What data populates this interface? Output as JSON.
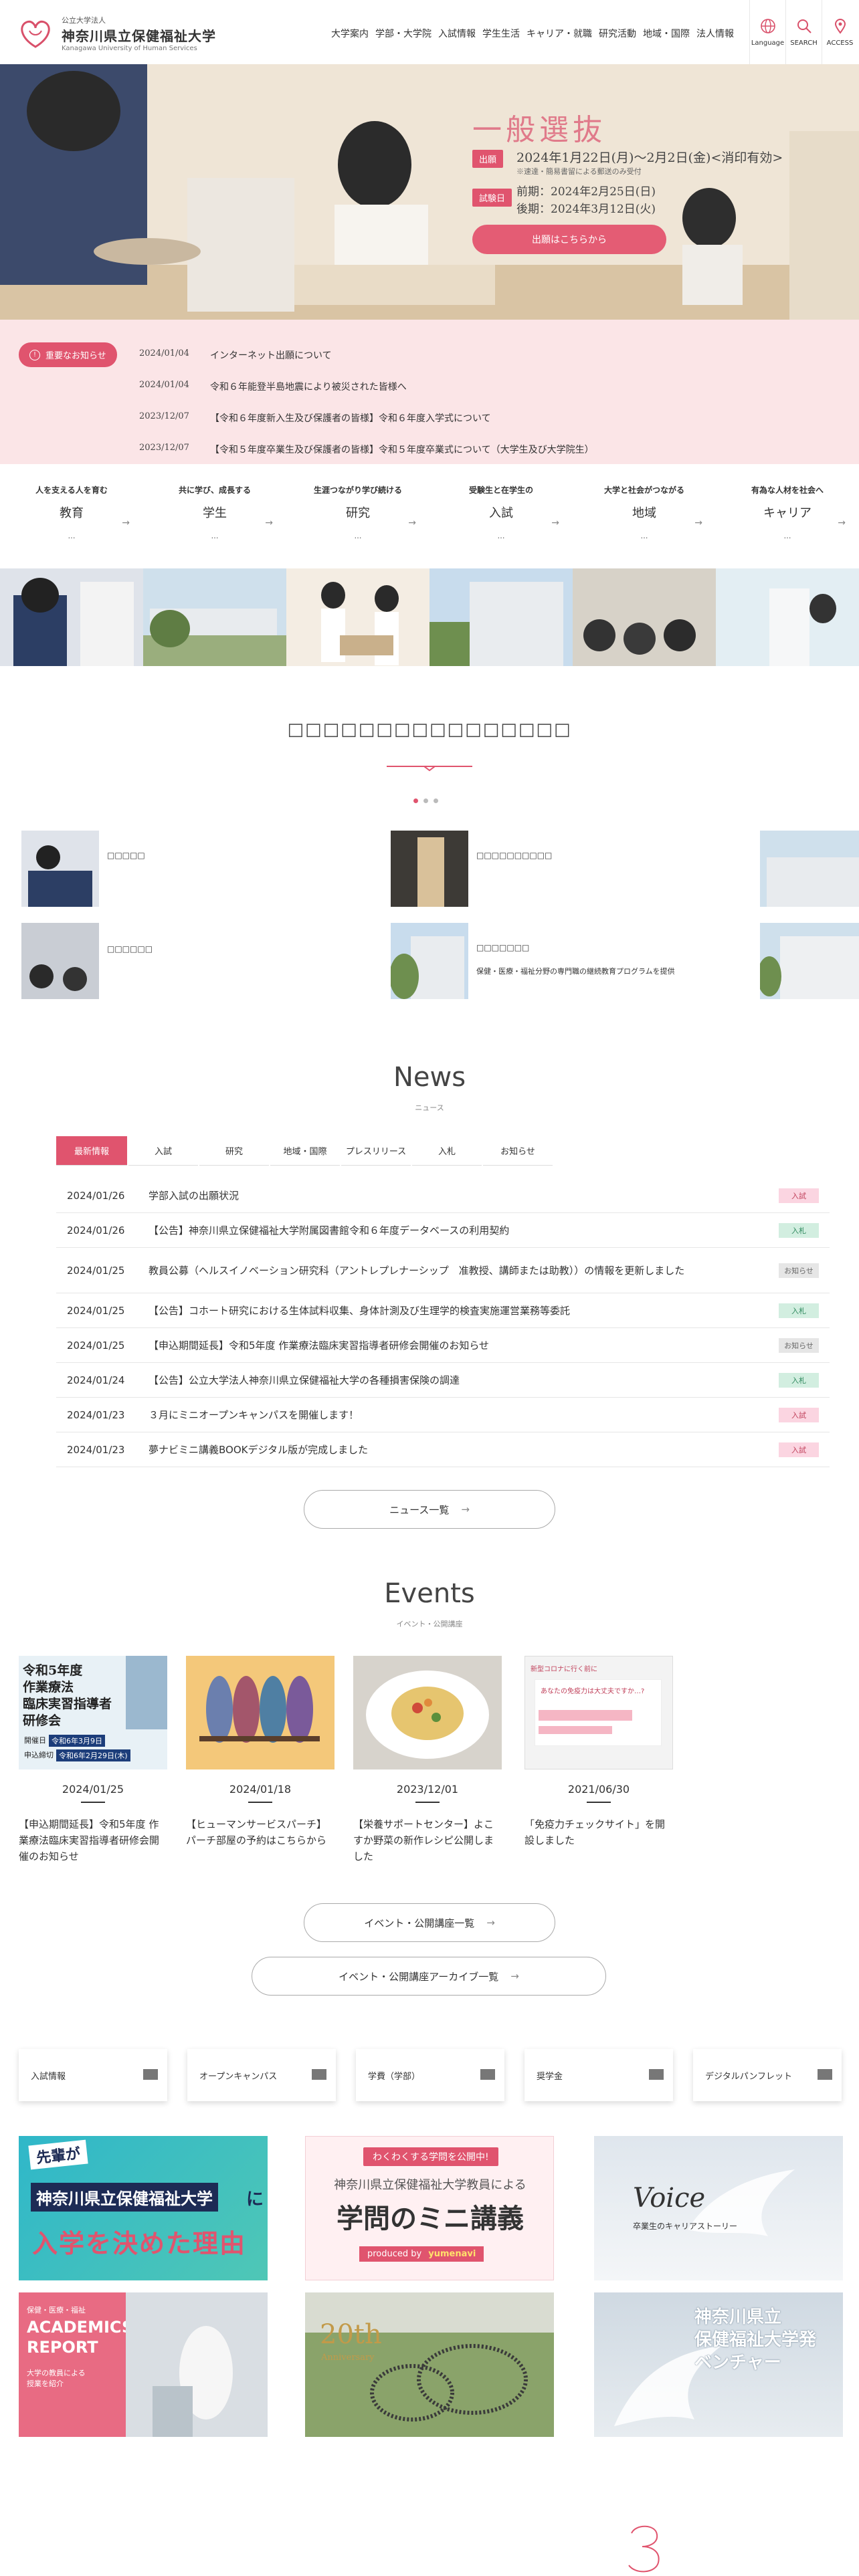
{
  "header": {
    "logo_top": "公立大学法人",
    "logo_name": "神奈川県立保健福祉大学",
    "logo_en": "Kanagawa University of Human Services",
    "nav": [
      "大学案内",
      "学部・大学院",
      "入試情報",
      "学生生活",
      "キャリア・就職",
      "研究活動",
      "地域・国際",
      "法人情報"
    ],
    "tools": [
      {
        "label": "Language",
        "icon": "globe-icon"
      },
      {
        "label": "SEARCH",
        "icon": "search-icon"
      },
      {
        "label": "ACCESS",
        "icon": "map-pin-icon"
      }
    ]
  },
  "hero": {
    "title": "一般選抜",
    "tag1": "出願",
    "line1": "2024年1月22日(月)～2月2日(金)<消印有効>",
    "line1b": "※速達・簡易書留による郵送のみ受付",
    "tag2": "試験日",
    "line2": "前期：2024年2月25日(日)",
    "line3": "後期：2024年3月12日(火)",
    "button": "出願はこちらから"
  },
  "notice": {
    "badge": "重要なお知らせ",
    "items": [
      {
        "date": "2024/01/04",
        "text": "インターネット出願について"
      },
      {
        "date": "2024/01/04",
        "text": "令和６年能登半島地震により被災された皆様へ"
      },
      {
        "date": "2023/12/07",
        "text": "【令和６年度新入生及び保護者の皆様】令和６年度入学式について"
      },
      {
        "date": "2023/12/07",
        "text": "【令和５年度卒業生及び保護者の皆様】令和５年度卒業式について（大学生及び大学院生）"
      }
    ]
  },
  "concepts": [
    {
      "head": "人を支える人を育む",
      "title": "教育",
      "sub": "…"
    },
    {
      "head": "共に学び、成長する",
      "title": "学生",
      "sub": "…"
    },
    {
      "head": "生涯つながり学び続ける",
      "title": "研究",
      "sub": "…"
    },
    {
      "head": "受験生と在学生の",
      "title": "入試",
      "sub": "…"
    },
    {
      "head": "大学と社会がつながる",
      "title": "地域",
      "sub": "…"
    },
    {
      "head": "有為な人材を社会へ",
      "title": "キャリア",
      "sub": "…"
    }
  ],
  "mid": {
    "heading": "□□□□□□□□□□□□□□□□",
    "items": [
      {
        "label": "□□□□□",
        "extra": ""
      },
      {
        "label": "□□□□□□□□□□",
        "extra": ""
      },
      {
        "label": "□□□□□□",
        "extra": ""
      },
      {
        "label": "□□□□□□□",
        "extra": "保健・医療・福祉分野の専門職の継続教育プログラムを提供"
      }
    ]
  },
  "news": {
    "title": "News",
    "subtitle": "ニュース",
    "tabs": [
      "最新情報",
      "入試",
      "研究",
      "地域・国際",
      "プレスリリース",
      "入札",
      "お知らせ"
    ],
    "active_tab": 0,
    "rows": [
      {
        "date": "2024/01/26",
        "text": "学部入試の出願状況",
        "badge": "入試",
        "kind": "pink"
      },
      {
        "date": "2024/01/26",
        "text": "【公告】神奈川県立保健福祉大学附属図書館令和６年度データベースの利用契約",
        "badge": "入札",
        "kind": "green"
      },
      {
        "date": "2024/01/25",
        "text": "教員公募（ヘルスイノベーション研究科（アントレプレナーシップ　准教授、講師または助教））の情報を更新しました",
        "badge": "お知らせ",
        "kind": "gray"
      },
      {
        "date": "2024/01/25",
        "text": "【公告】コホート研究における生体試料収集、身体計測及び生理学的検査実施運営業務等委託",
        "badge": "入札",
        "kind": "green"
      },
      {
        "date": "2024/01/25",
        "text": "【申込期間延長】令和5年度 作業療法臨床実習指導者研修会開催のお知らせ",
        "badge": "お知らせ",
        "kind": "gray"
      },
      {
        "date": "2024/01/24",
        "text": "【公告】公立大学法人神奈川県立保健福祉大学の各種損害保険の調達",
        "badge": "入札",
        "kind": "green"
      },
      {
        "date": "2024/01/23",
        "text": "３月にミニオープンキャンパスを開催します！",
        "badge": "入試",
        "kind": "pink"
      },
      {
        "date": "2024/01/23",
        "text": "夢ナビミニ講義BOOKデジタル版が完成しました",
        "badge": "入試",
        "kind": "pink"
      }
    ],
    "more": "ニュース一覧"
  },
  "events": {
    "title": "Events",
    "subtitle": "イベント・公開講座",
    "poster_text": [
      "令和5年度",
      "作業療法",
      "臨床実習指導者",
      "研修会",
      "開催日",
      "令和6年3月9日",
      "申込締切",
      "令和6年2月29日(木)"
    ],
    "covid_text": [
      "新型コロナに行く前に",
      "あなたの免疫力は大丈夫ですか…?"
    ],
    "items": [
      {
        "date": "2024/01/25",
        "text": "【申込期間延長】令和5年度 作業療法臨床実習指導者研修会開催のお知らせ"
      },
      {
        "date": "2024/01/18",
        "text": "【ヒューマンサービスパーチ】パーチ部屋の予約はこちらから"
      },
      {
        "date": "2023/12/01",
        "text": "【栄養サポートセンター】よこすか野菜の新作レシピ公開しました"
      },
      {
        "date": "2021/06/30",
        "text": "「免疫力チェックサイト」を開設しました"
      }
    ],
    "btn1": "イベント・公開講座一覧",
    "btn2": "イベント・公開講座アーカイブ一覧"
  },
  "quicklinks": [
    "入試情報",
    "オープンキャンパス",
    "学費（学部）",
    "奨学金",
    "デジタルパンフレット"
  ],
  "banners": {
    "b1_a": "先輩が",
    "b1_b": "神奈川県立保健福祉大学",
    "b1_c": "に",
    "b1_d": "入学を決めた理由",
    "b2_a": "わくわくする学問を公開中!",
    "b2_b": "神奈川県立保健福祉大学教員による",
    "b2_c": "学問のミニ講義",
    "b2_d": "produced by",
    "b2_e": "yumenavi",
    "b3_a": "Voice",
    "b3_b": "卒業生のキャリアストーリー",
    "b4_a": "保健・医療・福祉",
    "b4_b": "ACADEMICS",
    "b4_c": "REPORT",
    "b4_d": "大学の教員による",
    "b4_e": "授業を紹介",
    "b5_a": "20th",
    "b5_b": "Anniversary",
    "b6_a": "神奈川県立",
    "b6_b": "保健福祉大学発",
    "b6_c": "ベンチャー"
  },
  "colors": {
    "accent": "#e0546e",
    "notice_bg": "#fbe5e7",
    "pink_badge": "#fbd5e1",
    "green_badge": "#d2eee0",
    "gray_badge": "#e6e6e6"
  }
}
